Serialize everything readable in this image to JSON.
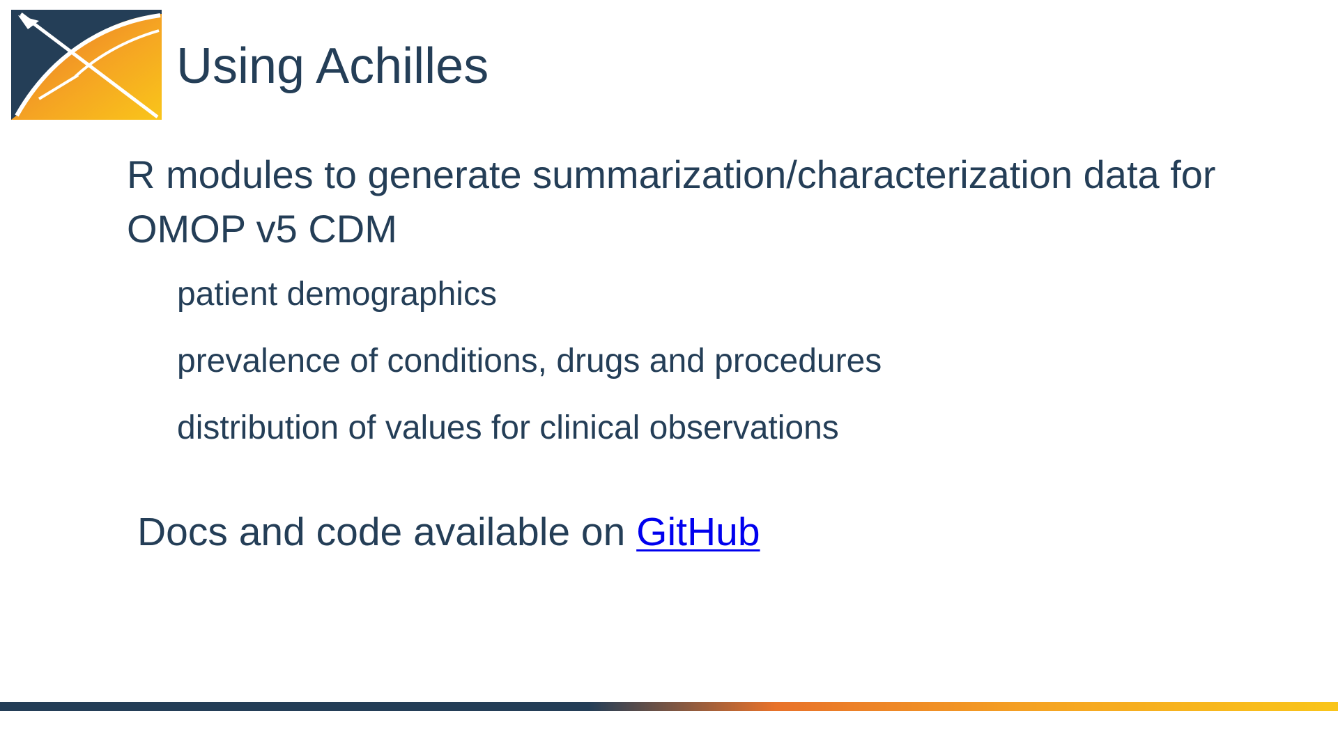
{
  "slide": {
    "title": "Using Achilles",
    "body_line": "R modules to generate summarization/characterization data for OMOP v5 CDM",
    "bullets": [
      "patient demographics",
      "prevalence of conditions, drugs and procedures",
      "distribution of values for clinical observations"
    ],
    "docs_prefix": "Docs and code available on ",
    "docs_link_label": "GitHub"
  },
  "logo": {
    "icon": "ohdsi-logo-icon",
    "colors": {
      "navy": "#243e57",
      "orange": "#ef8422",
      "yellow": "#f9c51a",
      "white": "#ffffff"
    }
  },
  "colors": {
    "text": "#243e57",
    "link": "#0000ee",
    "footer_start": "#243e57",
    "footer_mid": "#e8722a",
    "footer_end": "#f9c51a"
  }
}
